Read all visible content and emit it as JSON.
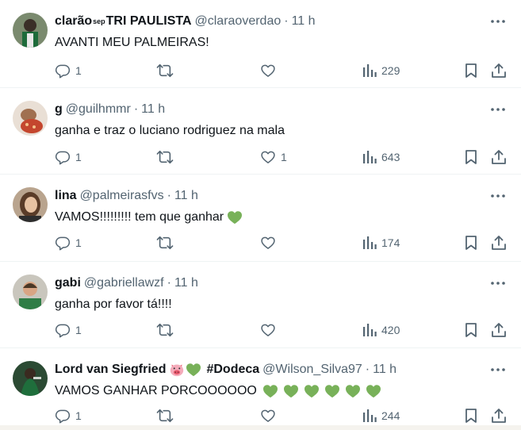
{
  "tweets": [
    {
      "name": "clarão",
      "sup": "sep",
      "name_suffix": "TRI PAULISTA",
      "handle": "@claraoverdao",
      "time": "11 h",
      "text": "AVANTI MEU PALMEIRAS!",
      "replies": "1",
      "retweets": "",
      "likes": "",
      "views": "229",
      "text_hearts": 0
    },
    {
      "name": "g",
      "handle": "@guilhmmr",
      "time": "11 h",
      "text": "ganha e traz o luciano rodriguez na mala",
      "replies": "1",
      "retweets": "",
      "likes": "1",
      "views": "643",
      "text_hearts": 0
    },
    {
      "name": "lina",
      "handle": "@palmeirasfvs",
      "time": "11 h",
      "text": "VAMOS!!!!!!!!! tem que ganhar",
      "replies": "1",
      "retweets": "",
      "likes": "",
      "views": "174",
      "text_hearts": 1
    },
    {
      "name": "gabi",
      "handle": "@gabriellawzf",
      "time": "11 h",
      "text": "ganha por favor tá!!!!",
      "replies": "1",
      "retweets": "",
      "likes": "",
      "views": "420",
      "text_hearts": 0
    },
    {
      "name": "Lord van Siegfried",
      "name_hashtag": "#Dodeca",
      "handle": "@Wilson_Silva97",
      "time": "11 h",
      "text": "VAMOS GANHAR PORCOOOOOO",
      "replies": "1",
      "retweets": "",
      "likes": "",
      "views": "244",
      "text_hearts": 6
    }
  ],
  "separator": "·",
  "colors": {
    "text": "#0f1419",
    "secondary": "#536471",
    "border": "#eff3f4",
    "green_heart": "#78b159",
    "pig_pink": "#f4abba"
  },
  "icons": [
    "more-icon",
    "reply-icon",
    "retweet-icon",
    "like-icon",
    "views-icon",
    "bookmark-icon",
    "share-icon",
    "green-heart-emoji",
    "pig-face-emoji"
  ]
}
